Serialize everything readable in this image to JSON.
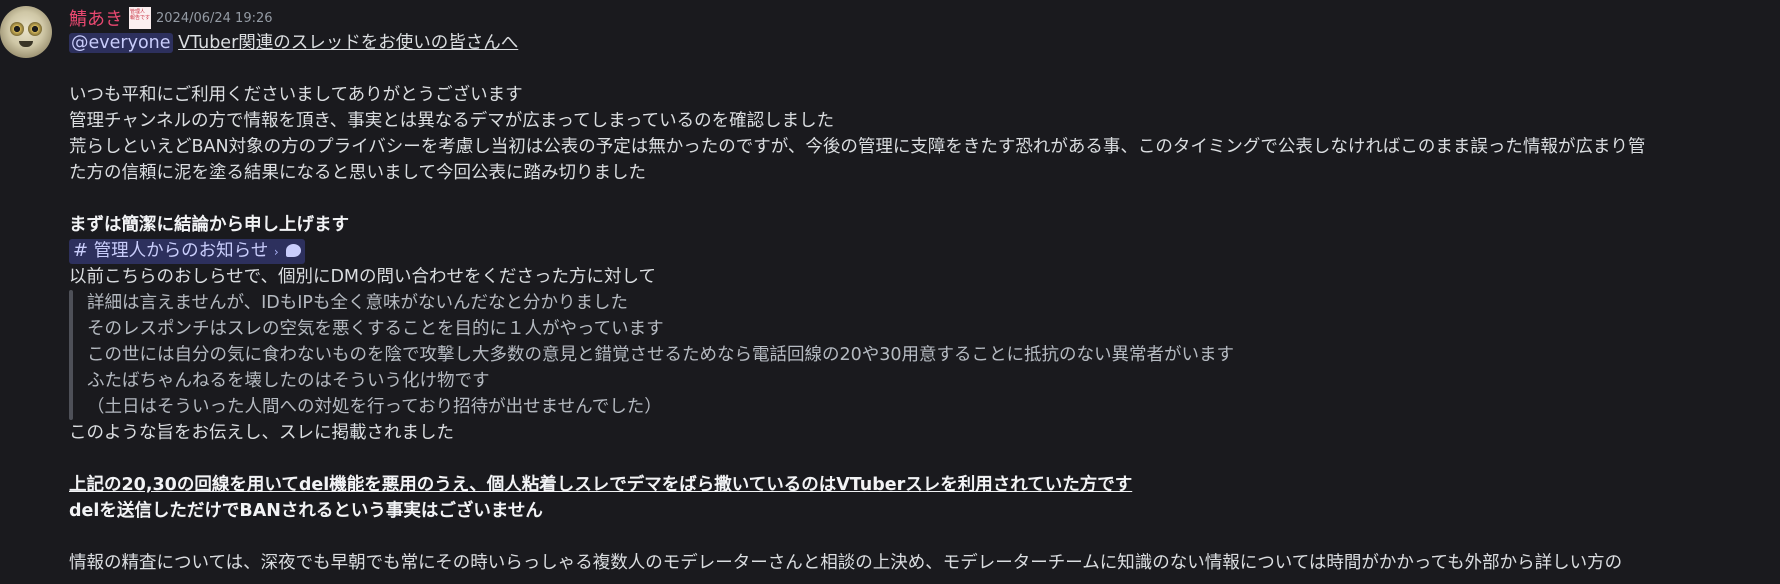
{
  "message": {
    "author": "鯖あき",
    "role_icon_text": [
      "管理人",
      "報告です"
    ],
    "timestamp": "2024/06/24 19:26",
    "mention": "@everyone",
    "subject": "VTuber関連のスレッドをお使いの皆さんへ",
    "paragraph1": [
      "いつも平和にご利用くださいましてありがとうございます",
      "管理チャンネルの方で情報を頂き、事実とは異なるデマが広まってしまっているのを確認しました",
      "荒らしといえどBAN対象の方のプライバシーを考慮し当初は公表の予定は無かったのですが、今後の管理に支障をきたす恐れがある事、このタイミングで公表しなければこのまま誤った情報が広まり管",
      "た方の信頼に泥を塗る結果になると思いまして今回公表に踏み切りました"
    ],
    "heading": "まずは簡潔に結論から申し上げます",
    "channel": {
      "hash": "#",
      "name": "管理人からのお知らせ",
      "chevron": "›",
      "thread_icon": "thread-bubble-icon"
    },
    "intro": "以前こちらのおしらせで、個別にDMの問い合わせをくださった方に対して",
    "quote": [
      "詳細は言えませんが、IDもIPも全く意味がないんだなと分かりました",
      "そのレスポンチはスレの空気を悪くすることを目的に１人がやっています",
      "この世には自分の気に食わないものを陰で攻撃し大多数の意見と錯覚させるためなら電話回線の20や30用意することに抵抗のない異常者がいます",
      "ふたばちゃんねるを壊したのはそういう化け物です",
      "（土日はそういった人間への対処を行っており招待が出せませんでした）"
    ],
    "after_quote": "このような旨をお伝えし、スレに掲載されました",
    "conclusion_underlined": "上記の20,30の回線を用いてdel機能を悪用のうえ、個人粘着しスレでデマをばら撒いているのはVTuberスレを利用されていた方です",
    "conclusion2": "delを送信しただけでBANされるという事実はございません",
    "last_line": "情報の精査については、深夜でも早朝でも常にその時いらっしゃる複数人のモデレーターさんと相談の上決め、モデレーターチームに知識のない情報については時間がかかっても外部から詳しい方の"
  },
  "colors": {
    "background": "#1a1a1e",
    "username": "#e84870",
    "mention_bg": "#3b3f6e",
    "text": "#dbdee1",
    "quote_text": "#b5bac1",
    "timestamp": "#949ba4"
  }
}
